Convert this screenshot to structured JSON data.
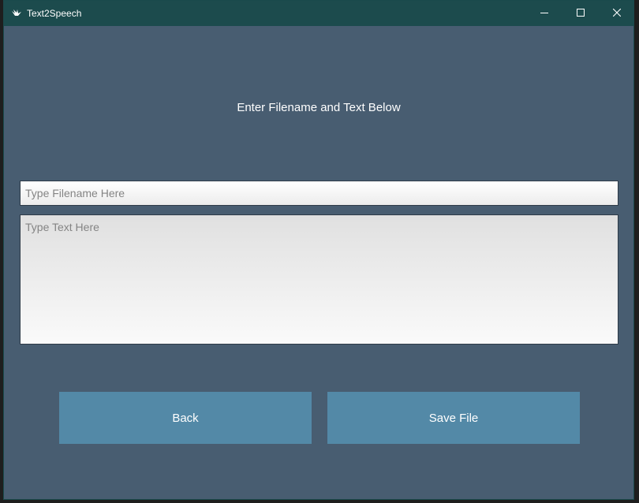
{
  "window": {
    "title": "Text2Speech",
    "icon": "kivy-logo-icon",
    "controls": {
      "minimize_icon": "minimize-icon",
      "maximize_icon": "maximize-icon",
      "close_icon": "close-icon"
    }
  },
  "main": {
    "heading": "Enter Filename and Text Below",
    "filename_input": {
      "value": "",
      "placeholder": "Type Filename Here"
    },
    "text_input": {
      "value": "",
      "placeholder": "Type Text Here"
    },
    "buttons": {
      "back_label": "Back",
      "save_label": "Save File"
    }
  },
  "colors": {
    "titlebar": "#1c4b4d",
    "background": "#485d71",
    "button": "#5389a7",
    "text": "#ffffff",
    "placeholder": "#848484"
  }
}
